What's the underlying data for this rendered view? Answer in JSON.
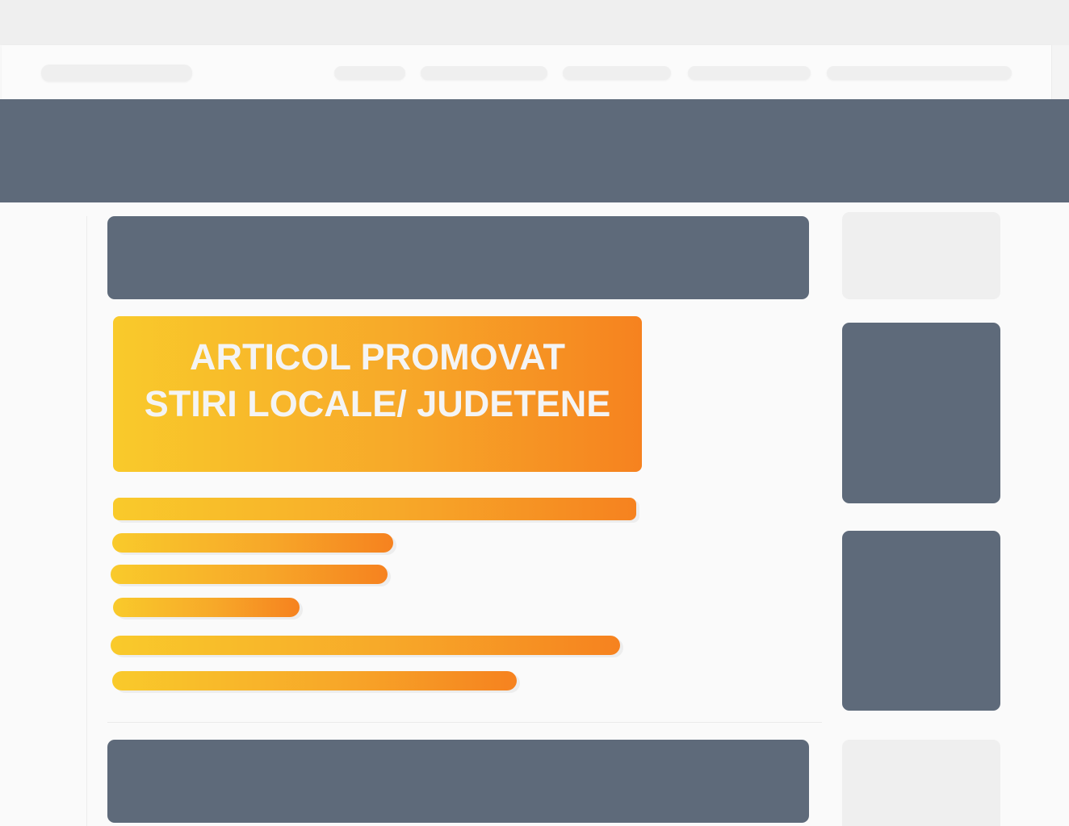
{
  "promo": {
    "line1": "ARTICOL PROMOVAT",
    "line2": "STIRI LOCALE/ JUDETENE"
  },
  "colors": {
    "slate": "#5e6a7a",
    "gradient_start": "#f9ca2b",
    "gradient_end": "#f6821f",
    "placeholder_grey": "#efefef"
  }
}
